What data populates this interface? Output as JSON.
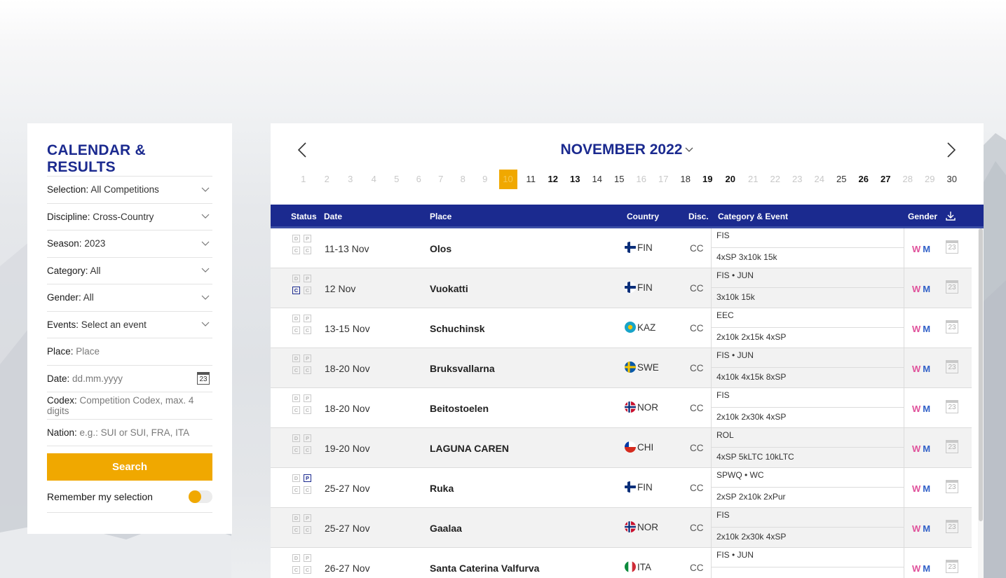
{
  "sidebar": {
    "title": "CALENDAR & RESULTS",
    "filters": [
      {
        "label": "Selection:",
        "value": "All Competitions",
        "type": "select"
      },
      {
        "label": "Discipline:",
        "value": "Cross-Country",
        "type": "select"
      },
      {
        "label": "Season:",
        "value": "2023",
        "type": "select"
      },
      {
        "label": "Category:",
        "value": "All",
        "type": "select"
      },
      {
        "label": "Gender:",
        "value": "All",
        "type": "select"
      },
      {
        "label": "Events:",
        "value": "Select an event",
        "type": "select"
      },
      {
        "label": "Place:",
        "placeholder": "Place",
        "type": "input"
      },
      {
        "label": "Date:",
        "placeholder": "dd.mm.yyyy",
        "type": "date",
        "icon_text": "23"
      },
      {
        "label": "Codex:",
        "placeholder": "Competition Codex, max. 4 digits",
        "type": "input"
      },
      {
        "label": "Nation:",
        "placeholder": "e.g.: SUI or SUI, FRA, ITA",
        "type": "input"
      }
    ],
    "search_label": "Search",
    "remember_label": "Remember my selection",
    "remember_on": true
  },
  "calendar": {
    "month_label": "NOVEMBER 2022",
    "selected_day": 10,
    "days": [
      {
        "n": "1",
        "s": "faded"
      },
      {
        "n": "2",
        "s": "faded"
      },
      {
        "n": "3",
        "s": "faded"
      },
      {
        "n": "4",
        "s": "faded"
      },
      {
        "n": "5",
        "s": "faded"
      },
      {
        "n": "6",
        "s": "faded"
      },
      {
        "n": "7",
        "s": "faded"
      },
      {
        "n": "8",
        "s": "faded"
      },
      {
        "n": "9",
        "s": "faded"
      },
      {
        "n": "10",
        "s": "today"
      },
      {
        "n": "11",
        "s": "cur"
      },
      {
        "n": "12",
        "s": "bold"
      },
      {
        "n": "13",
        "s": "bold"
      },
      {
        "n": "14",
        "s": "cur"
      },
      {
        "n": "15",
        "s": "cur"
      },
      {
        "n": "16",
        "s": "faded"
      },
      {
        "n": "17",
        "s": "faded"
      },
      {
        "n": "18",
        "s": "cur"
      },
      {
        "n": "19",
        "s": "bold"
      },
      {
        "n": "20",
        "s": "bold"
      },
      {
        "n": "21",
        "s": "faded"
      },
      {
        "n": "22",
        "s": "faded"
      },
      {
        "n": "23",
        "s": "faded"
      },
      {
        "n": "24",
        "s": "faded"
      },
      {
        "n": "25",
        "s": "cur"
      },
      {
        "n": "26",
        "s": "bold"
      },
      {
        "n": "27",
        "s": "bold"
      },
      {
        "n": "28",
        "s": "faded"
      },
      {
        "n": "29",
        "s": "faded"
      },
      {
        "n": "30",
        "s": "cur"
      }
    ]
  },
  "table": {
    "headers": {
      "status": "Status",
      "date": "Date",
      "place": "Place",
      "country": "Country",
      "disc": "Disc.",
      "category": "Category & Event",
      "gender": "Gender"
    },
    "rows": [
      {
        "status": {
          "d": false,
          "p": false,
          "c1": false,
          "c2": false
        },
        "date": "11-13 Nov",
        "place": "Olos",
        "flag": "fin",
        "country": "FIN",
        "disc": "CC",
        "cat": "FIS",
        "events": "4xSP 3x10k 15k",
        "w": "W",
        "m": "M",
        "cal": "23"
      },
      {
        "status": {
          "d": false,
          "p": false,
          "c1": true,
          "c2": false
        },
        "date": "12 Nov",
        "place": "Vuokatti",
        "flag": "fin",
        "country": "FIN",
        "disc": "CC",
        "cat": "FIS • JUN",
        "events": "3x10k 15k",
        "w": "W",
        "m": "M",
        "cal": "23"
      },
      {
        "status": {
          "d": false,
          "p": false,
          "c1": false,
          "c2": false
        },
        "date": "13-15 Nov",
        "place": "Schuchinsk",
        "flag": "kaz",
        "country": "KAZ",
        "disc": "CC",
        "cat": "EEC",
        "events": "2x10k 2x15k 4xSP",
        "w": "W",
        "m": "M",
        "cal": "23"
      },
      {
        "status": {
          "d": false,
          "p": false,
          "c1": false,
          "c2": false
        },
        "date": "18-20 Nov",
        "place": "Bruksvallarna",
        "flag": "swe",
        "country": "SWE",
        "disc": "CC",
        "cat": "FIS • JUN",
        "events": "4x10k 4x15k 8xSP",
        "w": "W",
        "m": "M",
        "cal": "23"
      },
      {
        "status": {
          "d": false,
          "p": false,
          "c1": false,
          "c2": false
        },
        "date": "18-20 Nov",
        "place": "Beitostoelen",
        "flag": "nor",
        "country": "NOR",
        "disc": "CC",
        "cat": "FIS",
        "events": "2x10k 2x30k 4xSP",
        "w": "W",
        "m": "M",
        "cal": "23"
      },
      {
        "status": {
          "d": false,
          "p": false,
          "c1": false,
          "c2": false
        },
        "date": "19-20 Nov",
        "place": "LAGUNA CAREN",
        "flag": "chi",
        "country": "CHI",
        "disc": "CC",
        "cat": "ROL",
        "events": "4xSP 5kLTC 10kLTC",
        "w": "W",
        "m": "M",
        "cal": "23"
      },
      {
        "status": {
          "d": false,
          "p": true,
          "c1": false,
          "c2": false
        },
        "date": "25-27 Nov",
        "place": "Ruka",
        "flag": "fin",
        "country": "FIN",
        "disc": "CC",
        "cat": "SPWQ • WC",
        "events": "2xSP 2x10k 2xPur",
        "w": "W",
        "m": "M",
        "cal": "23"
      },
      {
        "status": {
          "d": false,
          "p": false,
          "c1": false,
          "c2": false
        },
        "date": "25-27 Nov",
        "place": "Gaalaa",
        "flag": "nor",
        "country": "NOR",
        "disc": "CC",
        "cat": "FIS",
        "events": "2x10k 2x30k 4xSP",
        "w": "W",
        "m": "M",
        "cal": "23"
      },
      {
        "status": {
          "d": false,
          "p": false,
          "c1": false,
          "c2": false
        },
        "date": "26-27 Nov",
        "place": "Santa Caterina Valfurva",
        "flag": "ita",
        "country": "ITA",
        "disc": "CC",
        "cat": "FIS • JUN",
        "events": "",
        "w": "W",
        "m": "M",
        "cal": "23"
      }
    ],
    "status_letters": {
      "d": "D",
      "p": "P",
      "c": "C"
    }
  },
  "colors": {
    "accent": "#f0a800",
    "brand": "#1b2a8f",
    "women": "#e0529b",
    "men": "#2f5fc7"
  },
  "icons": [
    "chevron-down-icon",
    "calendar-icon",
    "chevron-left-icon",
    "chevron-right-icon",
    "download-icon",
    "flag-icon"
  ]
}
